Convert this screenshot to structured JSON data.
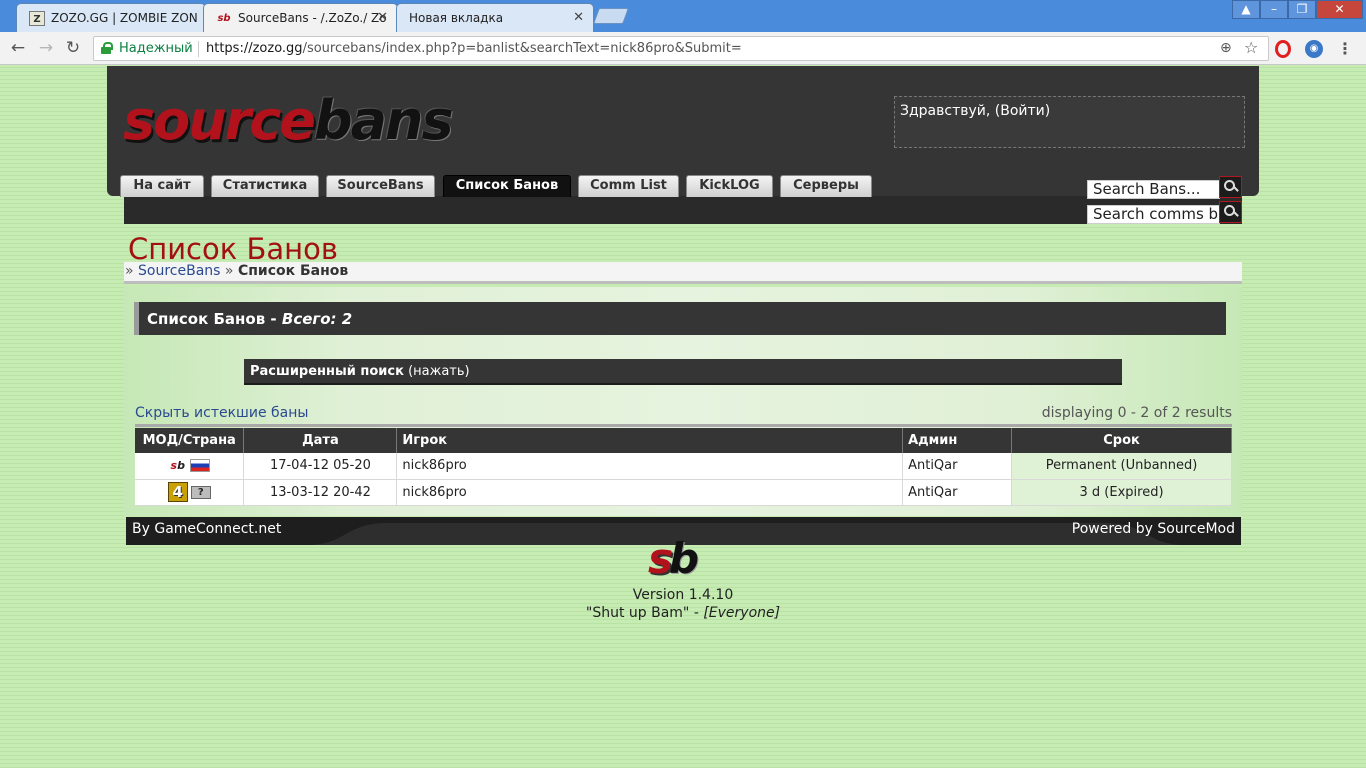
{
  "browser": {
    "tabs": [
      {
        "title": "ZOZO.GG | ZOMBIE ZON",
        "favicon": "Z"
      },
      {
        "title": "SourceBans - /.ZoZo./ Zo",
        "favicon": "sb"
      },
      {
        "title": "Новая вкладка",
        "favicon": ""
      }
    ],
    "secure_label": "Надежный",
    "url_prefix": "https://zozo.gg",
    "url_rest": "/sourcebans/index.php?p=banlist&searchText=nick86pro&Submit=",
    "window_buttons": [
      "▲",
      "–",
      "❐",
      "✕"
    ]
  },
  "header": {
    "logo_source": "source",
    "logo_bans": "bans",
    "greeting": "Здравствуй,",
    "login_link": "(Войти)",
    "nav": [
      "На сайт",
      "Статистика",
      "SourceBans",
      "Список Банов",
      "Comm List",
      "KickLOG",
      "Серверы"
    ],
    "search_bans_placeholder": "Search Bans...",
    "search_comms_placeholder": "Search comms b"
  },
  "page": {
    "title": "Список Банов",
    "breadcrumb_sep": "»",
    "breadcrumb_link": "SourceBans",
    "breadcrumb_current": "Список Банов",
    "box_title": "Список Банов -",
    "box_total": "Всего: 2",
    "adv_search_label": "Расширенный поиск",
    "adv_search_action": "(нажать)",
    "hide_expired": "Скрыть истекшие баны",
    "displaying": "displaying 0 - 2 of 2 results"
  },
  "table": {
    "headers": [
      "МОД/Страна",
      "Дата",
      "Игрок",
      "Админ",
      "Срок"
    ],
    "rows": [
      {
        "mod": "sourcebans-icon",
        "country": "russia-flag",
        "date": "17-04-12 05-20",
        "player": "nick86pro",
        "admin": "AntiQar",
        "length": "Permanent (Unbanned)"
      },
      {
        "mod": "l4d-icon",
        "country": "unknown-flag",
        "date": "13-03-12 20-42",
        "player": "nick86pro",
        "admin": "AntiQar",
        "length": "3 d (Expired)"
      }
    ]
  },
  "footer": {
    "left": "By GameConnect.net",
    "right": "Powered by SourceMod",
    "version": "Version 1.4.10",
    "quote": "\"Shut up Bam\" -",
    "quote_author": "[Everyone]"
  },
  "colors": {
    "accent_red": "#a31010",
    "header_dark": "#353535",
    "link_blue": "#2a4a90"
  }
}
